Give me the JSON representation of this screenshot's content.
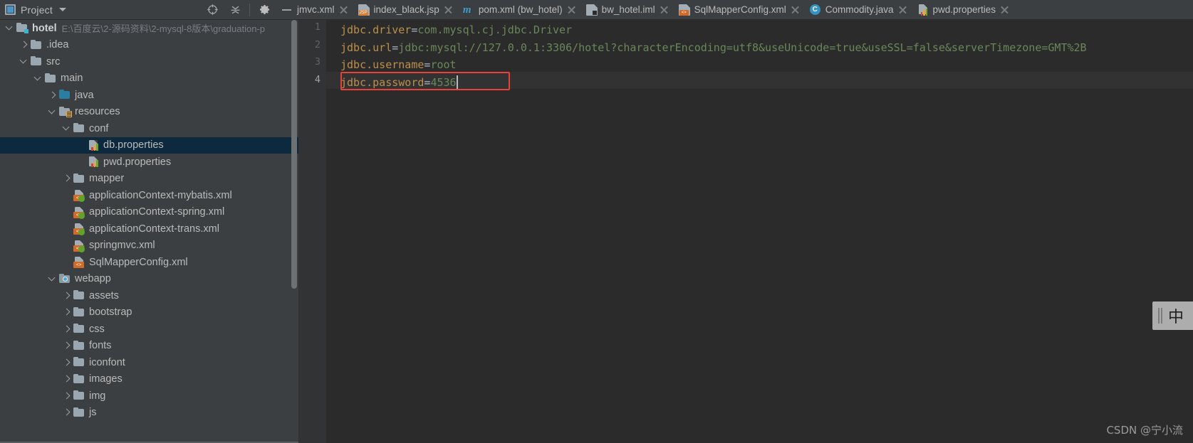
{
  "window": {
    "panel_title": "Project",
    "panel_title_icon": "project-window-icon",
    "toolbar_icons": [
      "locate-target-icon",
      "collapse-all-icon",
      "settings-gear-icon"
    ]
  },
  "tabs": [
    {
      "label": "jmvc.xml",
      "icon": "dash-icon",
      "closable": true
    },
    {
      "label": "index_black.jsp",
      "icon": "jsp-file-icon",
      "badge": "JSP",
      "closable": true
    },
    {
      "label": "pom.xml (bw_hotel)",
      "icon": "maven-m-icon",
      "closable": true
    },
    {
      "label": "bw_hotel.iml",
      "icon": "iml-module-icon",
      "closable": true
    },
    {
      "label": "SqlMapperConfig.xml",
      "icon": "xml-file-icon",
      "badge": "<>",
      "closable": true
    },
    {
      "label": "Commodity.java",
      "icon": "java-class-icon",
      "badge": "C",
      "closable": true
    },
    {
      "label": "pwd.properties",
      "icon": "properties-file-icon",
      "closable": true
    }
  ],
  "project_tree": [
    {
      "label": "hotel",
      "secondary": "E:\\百度云\\2-源码资料\\2-mysql-8版本\\graduation-p",
      "depth": 0,
      "arrow": "down",
      "icon": "module-folder-icon",
      "bold": true,
      "selected": false
    },
    {
      "label": ".idea",
      "secondary": "",
      "depth": 1,
      "arrow": "right",
      "icon": "folder-icon",
      "bold": false,
      "selected": false
    },
    {
      "label": "src",
      "secondary": "",
      "depth": 1,
      "arrow": "down",
      "icon": "folder-icon",
      "bold": false,
      "selected": false
    },
    {
      "label": "main",
      "secondary": "",
      "depth": 2,
      "arrow": "down",
      "icon": "folder-icon",
      "bold": false,
      "selected": false
    },
    {
      "label": "java",
      "secondary": "",
      "depth": 3,
      "arrow": "right",
      "icon": "sources-folder-icon",
      "bold": false,
      "selected": false
    },
    {
      "label": "resources",
      "secondary": "",
      "depth": 3,
      "arrow": "down",
      "icon": "resources-folder-icon",
      "bold": false,
      "selected": false
    },
    {
      "label": "conf",
      "secondary": "",
      "depth": 4,
      "arrow": "down",
      "icon": "folder-icon",
      "bold": false,
      "selected": false
    },
    {
      "label": "db.properties",
      "secondary": "",
      "depth": 5,
      "arrow": "none",
      "icon": "properties-file-icon",
      "bold": false,
      "selected": true
    },
    {
      "label": "pwd.properties",
      "secondary": "",
      "depth": 5,
      "arrow": "none",
      "icon": "properties-file-icon",
      "bold": false,
      "selected": false
    },
    {
      "label": "mapper",
      "secondary": "",
      "depth": 4,
      "arrow": "right",
      "icon": "folder-icon",
      "bold": false,
      "selected": false
    },
    {
      "label": "applicationContext-mybatis.xml",
      "secondary": "",
      "depth": 4,
      "arrow": "none",
      "icon": "spring-xml-file-icon",
      "bold": false,
      "selected": false
    },
    {
      "label": "applicationContext-spring.xml",
      "secondary": "",
      "depth": 4,
      "arrow": "none",
      "icon": "spring-xml-file-icon",
      "bold": false,
      "selected": false
    },
    {
      "label": "applicationContext-trans.xml",
      "secondary": "",
      "depth": 4,
      "arrow": "none",
      "icon": "spring-xml-file-icon",
      "bold": false,
      "selected": false
    },
    {
      "label": "springmvc.xml",
      "secondary": "",
      "depth": 4,
      "arrow": "none",
      "icon": "spring-xml-file-icon",
      "bold": false,
      "selected": false
    },
    {
      "label": "SqlMapperConfig.xml",
      "secondary": "",
      "depth": 4,
      "arrow": "none",
      "icon": "xml-file-icon",
      "bold": false,
      "selected": false
    },
    {
      "label": "webapp",
      "secondary": "",
      "depth": 3,
      "arrow": "down",
      "icon": "webapp-folder-icon",
      "bold": false,
      "selected": false
    },
    {
      "label": "assets",
      "secondary": "",
      "depth": 4,
      "arrow": "right",
      "icon": "folder-icon",
      "bold": false,
      "selected": false
    },
    {
      "label": "bootstrap",
      "secondary": "",
      "depth": 4,
      "arrow": "right",
      "icon": "folder-icon",
      "bold": false,
      "selected": false
    },
    {
      "label": "css",
      "secondary": "",
      "depth": 4,
      "arrow": "right",
      "icon": "folder-icon",
      "bold": false,
      "selected": false
    },
    {
      "label": "fonts",
      "secondary": "",
      "depth": 4,
      "arrow": "right",
      "icon": "folder-icon",
      "bold": false,
      "selected": false
    },
    {
      "label": "iconfont",
      "secondary": "",
      "depth": 4,
      "arrow": "right",
      "icon": "folder-icon",
      "bold": false,
      "selected": false
    },
    {
      "label": "images",
      "secondary": "",
      "depth": 4,
      "arrow": "right",
      "icon": "folder-icon",
      "bold": false,
      "selected": false
    },
    {
      "label": "img",
      "secondary": "",
      "depth": 4,
      "arrow": "right",
      "icon": "folder-icon",
      "bold": false,
      "selected": false
    },
    {
      "label": "js",
      "secondary": "",
      "depth": 4,
      "arrow": "right",
      "icon": "folder-icon",
      "bold": false,
      "selected": false
    }
  ],
  "editor": {
    "active_file": "db.properties",
    "current_line": 4,
    "line_numbers": [
      "1",
      "2",
      "3",
      "4"
    ],
    "lines": [
      {
        "key": "jdbc.driver",
        "eq": "=",
        "value": "com.mysql.cj.jdbc.Driver"
      },
      {
        "key": "jdbc.url",
        "eq": "=",
        "value": "jdbc:mysql://127.0.0.1:3306/hotel?characterEncoding=utf8&useUnicode=true&useSSL=false&serverTimezone=GMT%2B"
      },
      {
        "key": "jdbc.username",
        "eq": "=",
        "value": "root"
      },
      {
        "key": "jdbc.password",
        "eq": "=",
        "value": "4536"
      }
    ],
    "highlight_box_color": "#E8413A",
    "highlight_box_line": 4,
    "colors": {
      "key": "#BC8F4A",
      "value": "#6A8759",
      "background": "#2B2B2B",
      "gutter": "#313335"
    }
  },
  "ime_widget": {
    "label": "中",
    "handle": "drag-grip"
  },
  "watermark": {
    "text": "CSDN @宁小流"
  }
}
